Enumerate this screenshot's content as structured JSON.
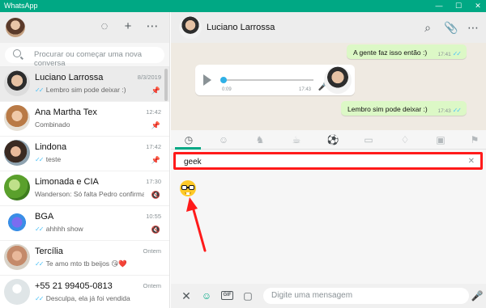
{
  "window": {
    "title": "WhatsApp",
    "controls": [
      "—",
      "☐",
      "✕"
    ]
  },
  "left": {
    "search_placeholder": "Procurar ou começar uma nova conversa",
    "chats": [
      {
        "name": "Luciano Larrossa",
        "time": "8/3/2019",
        "preview": "Lembro sim pode deixar :)",
        "ticks": "✓✓",
        "badge": "pin-icon",
        "active": true
      },
      {
        "name": "Ana Martha Tex",
        "time": "12:42",
        "preview": "Combinado",
        "ticks": "",
        "badge": "pin-icon"
      },
      {
        "name": "Lindona",
        "time": "17:42",
        "preview": "teste",
        "ticks": "✓✓",
        "badge": "pin-icon"
      },
      {
        "name": "Limonada e CIA",
        "time": "17:30",
        "preview": "Wanderson: Só falta Pedro confirmar...",
        "ticks": "",
        "badge": "mute-icon"
      },
      {
        "name": "BGA",
        "time": "10:55",
        "preview": "ahhhh show",
        "ticks": "✓✓",
        "badge": "mute-icon"
      },
      {
        "name": "Tercília",
        "time": "Ontem",
        "preview": "Te amo mto tb beijos 😘❤️",
        "ticks": "✓✓",
        "badge": ""
      },
      {
        "name": "+55 21 99405-0813",
        "time": "Ontem",
        "preview": "Desculpa, ela já foi vendida",
        "ticks": "✓✓",
        "badge": ""
      }
    ]
  },
  "right": {
    "contact_name": "Luciano Larrossa",
    "messages": {
      "m1": {
        "text": "A gente faz isso então :)",
        "time": "17:41",
        "ticks": "✓✓"
      },
      "voice": {
        "elapsed": "0:09",
        "time": "17:43"
      },
      "m2": {
        "text": "Lembro sim pode deixar :)",
        "time": "17:43",
        "ticks": "✓✓"
      }
    },
    "emoji": {
      "search_value": "geek",
      "clear": "✕",
      "result": "nerd-face",
      "tabs": [
        "recent-clock-icon",
        "smiley-icon",
        "animal-icon",
        "food-icon",
        "sports-icon",
        "car-icon",
        "bulb-icon",
        "symbols-icon",
        "flag-icon"
      ]
    },
    "composer": {
      "placeholder": "Digite uma mensagem",
      "gif_label": "GIF"
    }
  },
  "colors": {
    "accent": "#00a884",
    "highlight": "#ff1a1a",
    "bubble_out": "#dcf8c6",
    "tick_blue": "#4fc3f7"
  }
}
